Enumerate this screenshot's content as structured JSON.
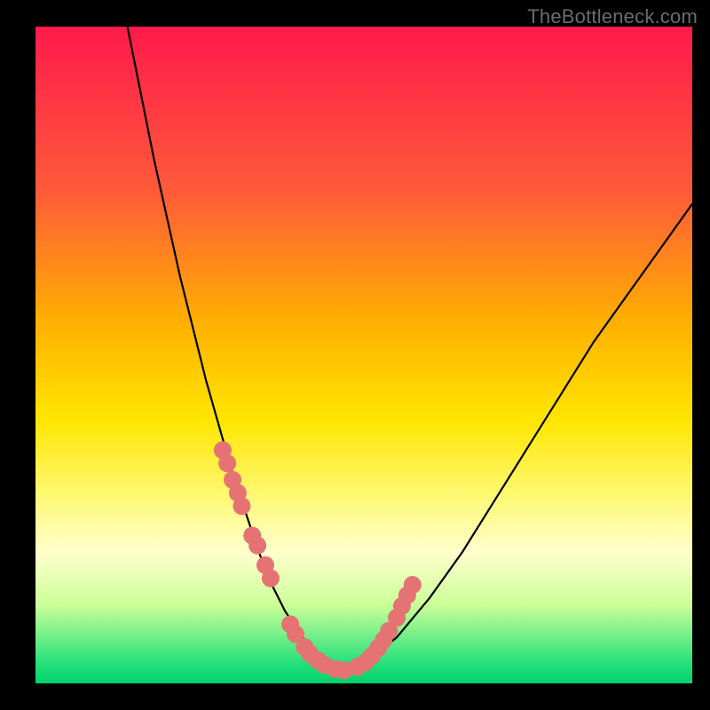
{
  "watermark": "TheBottleneck.com",
  "colors": {
    "background": "#000000",
    "dot": "#e57373",
    "curve_stroke": "#000000",
    "gradient_top": "#ff1a4b",
    "gradient_bottom": "#00d36a"
  },
  "chart_data": {
    "type": "line",
    "title": "",
    "xlabel": "",
    "ylabel": "",
    "xlim": [
      0,
      100
    ],
    "ylim": [
      0,
      100
    ],
    "x": [
      14,
      16,
      18,
      20,
      22,
      24,
      26,
      28,
      30,
      32,
      34,
      36,
      38,
      40,
      42,
      44,
      46,
      48,
      50,
      55,
      60,
      65,
      70,
      75,
      80,
      85,
      90,
      95,
      100
    ],
    "values": [
      100,
      90,
      80,
      71,
      62,
      54,
      46,
      39,
      32,
      26,
      20,
      15,
      11,
      8,
      5,
      3,
      2,
      2,
      3,
      7,
      13,
      20,
      28,
      36,
      44,
      52,
      59,
      66,
      73
    ],
    "series": [
      {
        "name": "highlighted-points",
        "x": [
          28.5,
          29.2,
          30.0,
          30.8,
          31.4,
          33.0,
          33.8,
          35.0,
          35.8,
          38.8,
          39.6,
          41.0,
          41.8,
          43.0,
          44.0,
          45.6,
          47.0,
          49.0,
          50.2,
          51.2,
          52.2,
          53.0,
          53.8,
          55.0,
          55.8,
          56.6,
          57.4
        ],
        "values": [
          35.5,
          33.5,
          31,
          29,
          27,
          22.5,
          21,
          18,
          16,
          9,
          7.5,
          5.5,
          4.5,
          3.5,
          2.8,
          2.2,
          2,
          2.5,
          3.2,
          4.2,
          5.4,
          6.6,
          8,
          10,
          11.8,
          13.4,
          15
        ]
      }
    ]
  }
}
